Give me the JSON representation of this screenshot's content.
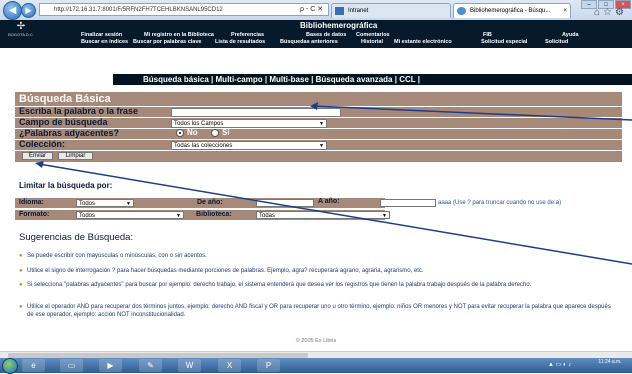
{
  "browser": {
    "address_url": "http://172.16.31.7:8001/F/5RFN2FH7TCEHLBKNSANL95CD12",
    "address_controls": "ρ - C ✕",
    "tabs": [
      {
        "label": "Intranet",
        "state": "inactive"
      },
      {
        "label": "Bibliohemerográfica - Búsqu...",
        "state": "active",
        "close": "×"
      }
    ]
  },
  "site": {
    "logo_text": "BOGOTA D.C.",
    "title": "Bibliohemerográfica",
    "menu_row1": [
      "Finalizar sesión",
      "Mi registro en la Biblioteca",
      "Preferencias",
      "Bases de datos",
      "Comentarios",
      "FIB",
      "Ayuda"
    ],
    "menu_row2": [
      "Buscar en índices",
      "Buscar por palabras clave",
      "Lista de resultados",
      "Búsquedas anteriores",
      "Historial",
      "Mi estante electrónico",
      "Solicitud especial",
      "Solicitud"
    ],
    "search_tabs": [
      "Búsqueda básica",
      "Multi-campo",
      "Multi-base",
      "Búsqueda avanzada",
      "CCL"
    ]
  },
  "form": {
    "title": "Búsqueda Básica",
    "word_label": "Escriba la palabra o la frase",
    "word_value": "",
    "field_label": "Campo de búsqueda",
    "field_value": "Todos los Campos",
    "adjacent_label": "¿Palabras adyacentes?",
    "adjacent_no": "No",
    "adjacent_si": "Si",
    "adjacent_selected": "No",
    "collection_label": "Colección:",
    "collection_value": "Todas las colecciones",
    "send_button": "Enviar",
    "clear_button": "Limpiar"
  },
  "limit": {
    "title": "Limitar la búsqueda por:",
    "idioma_label": "Idioma:",
    "idioma_value": "Todos",
    "de_ano_label": "De año:",
    "de_ano_value": "",
    "a_ano_label": "A año:",
    "a_ano_value": "",
    "year_hint": "aaaa (Use ? para truncar cuando no use de:a)",
    "formato_label": "Formato:",
    "formato_value": "Todos",
    "biblioteca_label": "Biblioteca:",
    "biblioteca_value": "Todas"
  },
  "suggestions": {
    "title": "Sugerencias de Búsqueda:",
    "items": [
      "Se puede escribir con mayúsculas o minúsculas, con o sin acentos.",
      "Utilice el signo de interrogación ? para hacer búsquedas mediante porciones de palabras. Ejemplo, agra? recuperará agrario, agraria, agrarismo, etc.",
      "Si selecciona \"palabras adyacentes\" para buscar por ejemplo: derecho trabajo, el sistema entenderá que desea ver los registros que tienen la palabra trabajo después de la palabra derecho.",
      "Utilice el operador AND para recuperar dos términos juntos, ejemplo: derecho AND fiscal y OR para recuperar uno u otro término, ejemplo: niños OR menores y NOT para evitar recuperar la palabra que aparece después de ese operador, ejemplo: acción NOT inconstitucionalidad."
    ]
  },
  "footer": "© 2005 Ex Libris",
  "taskbar": {
    "clock": "11:24 a.m."
  },
  "colors": {
    "header_bg": "#061a2c",
    "form_band": "#a68979",
    "label_text": "#0b1a35",
    "suggestion_text": "#1d3a73"
  }
}
